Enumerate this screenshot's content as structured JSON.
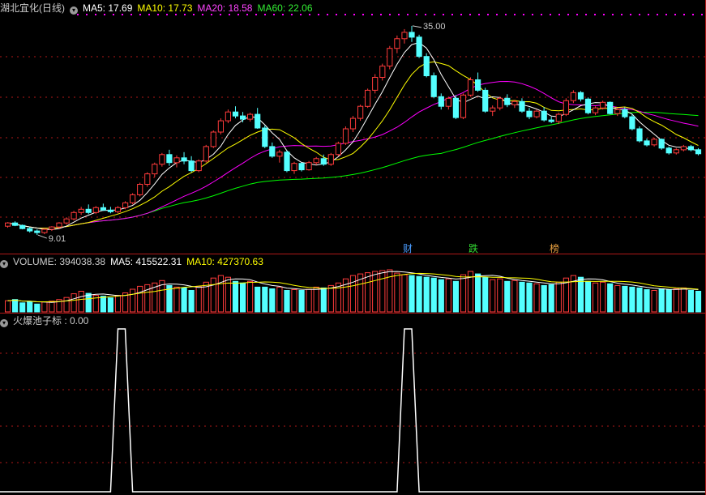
{
  "main_header": {
    "title": "湖北宜化(日线)",
    "ma5": "MA5: 17.69",
    "ma10": "MA10: 17.73",
    "ma20": "MA20: 18.58",
    "ma60": "MA60: 22.06"
  },
  "volume_header": {
    "title": "VOLUME: 394038.38",
    "ma5": "MA5: 415522.31",
    "ma10": "MA10: 427370.63"
  },
  "indicator_header": {
    "title": "火爆池子标 : 0.00"
  },
  "annotations": {
    "high": "35.00",
    "low": "9.01"
  },
  "events": [
    {
      "label": "财",
      "color": "#4a9cff"
    },
    {
      "label": "跌",
      "color": "#33dd33"
    },
    {
      "label": "榜",
      "color": "#e8a040"
    }
  ],
  "colors": {
    "up": "#ff3b3b",
    "down": "#54ffff",
    "ma5": "#ffffff",
    "ma10": "#ffff00",
    "ma20": "#ff00ff",
    "ma60": "#00ff00",
    "grid": "#b01818",
    "indicator": "#ffffff"
  },
  "chart_data": [
    {
      "type": "candlestick",
      "title": "湖北宜化(日线)",
      "ylim": [
        8,
        36
      ],
      "annotated_high": 35.0,
      "annotated_low": 9.01,
      "candles": [
        [
          10.1,
          10.6,
          9.9,
          10.5
        ],
        [
          10.5,
          10.7,
          10.1,
          10.2
        ],
        [
          10.2,
          10.3,
          9.7,
          9.8
        ],
        [
          9.8,
          10.0,
          9.3,
          9.5
        ],
        [
          9.5,
          9.7,
          9.0,
          9.3
        ],
        [
          9.3,
          9.8,
          9.1,
          9.7
        ],
        [
          9.7,
          10.1,
          9.5,
          10.0
        ],
        [
          10.0,
          10.6,
          9.8,
          10.5
        ],
        [
          10.5,
          11.2,
          10.3,
          11.0
        ],
        [
          11.0,
          12.0,
          10.8,
          11.8
        ],
        [
          11.8,
          12.5,
          11.5,
          12.2
        ],
        [
          12.2,
          12.8,
          11.6,
          11.8
        ],
        [
          11.8,
          12.6,
          11.6,
          12.4
        ],
        [
          12.4,
          12.9,
          12.0,
          12.1
        ],
        [
          12.1,
          12.5,
          11.7,
          11.9
        ],
        [
          11.9,
          12.6,
          11.7,
          12.4
        ],
        [
          12.4,
          13.2,
          12.2,
          13.0
        ],
        [
          13.0,
          14.2,
          12.8,
          14.0
        ],
        [
          14.0,
          15.5,
          13.8,
          15.3
        ],
        [
          15.3,
          16.8,
          15.0,
          16.6
        ],
        [
          16.6,
          18.0,
          16.2,
          17.8
        ],
        [
          17.8,
          19.2,
          17.5,
          19.0
        ],
        [
          19.0,
          19.6,
          17.6,
          18.0
        ],
        [
          18.0,
          18.9,
          17.4,
          18.6
        ],
        [
          18.6,
          19.3,
          17.8,
          18.2
        ],
        [
          18.2,
          18.8,
          16.8,
          17.0
        ],
        [
          17.0,
          18.4,
          16.8,
          18.2
        ],
        [
          18.2,
          20.2,
          18.0,
          20.0
        ],
        [
          20.0,
          22.0,
          19.8,
          21.8
        ],
        [
          21.8,
          23.5,
          21.5,
          23.2
        ],
        [
          23.2,
          24.6,
          22.9,
          24.3
        ],
        [
          24.3,
          25.0,
          23.5,
          23.8
        ],
        [
          23.8,
          24.3,
          23.0,
          23.4
        ],
        [
          23.4,
          24.2,
          23.1,
          24.0
        ],
        [
          24.0,
          24.8,
          22.2,
          22.3
        ],
        [
          22.3,
          22.6,
          19.8,
          20.0
        ],
        [
          20.0,
          20.5,
          18.6,
          18.8
        ],
        [
          18.8,
          19.6,
          18.0,
          19.3
        ],
        [
          19.3,
          19.5,
          16.8,
          17.0
        ],
        [
          17.0,
          18.1,
          16.6,
          17.9
        ],
        [
          17.9,
          18.0,
          16.9,
          17.1
        ],
        [
          17.1,
          18.2,
          17.0,
          18.0
        ],
        [
          18.0,
          18.7,
          17.7,
          18.5
        ],
        [
          18.5,
          19.0,
          17.6,
          17.8
        ],
        [
          17.8,
          19.2,
          17.6,
          19.0
        ],
        [
          19.0,
          20.6,
          18.8,
          20.4
        ],
        [
          20.4,
          22.5,
          20.2,
          22.2
        ],
        [
          22.2,
          23.8,
          21.8,
          23.5
        ],
        [
          23.5,
          25.2,
          23.2,
          25.0
        ],
        [
          25.0,
          27.2,
          24.8,
          27.0
        ],
        [
          27.0,
          29.0,
          26.6,
          28.6
        ],
        [
          28.6,
          30.3,
          28.2,
          30.0
        ],
        [
          30.0,
          32.5,
          29.6,
          32.2
        ],
        [
          32.2,
          33.8,
          31.6,
          33.4
        ],
        [
          33.4,
          34.6,
          32.8,
          34.2
        ],
        [
          34.2,
          35.0,
          33.0,
          33.6
        ],
        [
          33.6,
          33.9,
          31.0,
          31.2
        ],
        [
          31.2,
          31.6,
          28.6,
          28.8
        ],
        [
          28.8,
          29.2,
          26.0,
          26.2
        ],
        [
          26.2,
          26.6,
          24.6,
          25.0
        ],
        [
          25.0,
          26.2,
          24.6,
          26.0
        ],
        [
          26.0,
          26.4,
          23.4,
          23.6
        ],
        [
          23.6,
          26.6,
          23.4,
          26.4
        ],
        [
          26.4,
          28.6,
          26.2,
          28.3
        ],
        [
          28.3,
          29.2,
          26.8,
          27.0
        ],
        [
          27.0,
          27.3,
          24.2,
          24.4
        ],
        [
          24.4,
          25.1,
          23.8,
          24.8
        ],
        [
          24.8,
          26.2,
          24.5,
          26.0
        ],
        [
          26.0,
          26.5,
          24.9,
          25.2
        ],
        [
          25.2,
          25.8,
          24.8,
          25.6
        ],
        [
          25.6,
          26.0,
          24.2,
          24.4
        ],
        [
          24.4,
          24.8,
          23.4,
          23.7
        ],
        [
          23.7,
          24.6,
          23.5,
          24.4
        ],
        [
          24.4,
          24.9,
          23.1,
          23.3
        ],
        [
          23.3,
          23.7,
          22.9,
          23.1
        ],
        [
          23.1,
          24.2,
          22.8,
          24.0
        ],
        [
          24.0,
          26.0,
          23.8,
          25.7
        ],
        [
          25.7,
          27.0,
          25.4,
          26.7
        ],
        [
          26.7,
          26.9,
          25.6,
          25.9
        ],
        [
          25.9,
          26.1,
          24.0,
          24.2
        ],
        [
          24.2,
          25.0,
          23.9,
          24.8
        ],
        [
          24.8,
          25.7,
          24.6,
          25.5
        ],
        [
          25.5,
          25.6,
          24.0,
          24.1
        ],
        [
          24.1,
          24.8,
          23.8,
          24.6
        ],
        [
          24.6,
          24.9,
          23.5,
          23.7
        ],
        [
          23.7,
          24.0,
          22.0,
          22.2
        ],
        [
          22.2,
          22.5,
          20.5,
          20.7
        ],
        [
          20.7,
          21.0,
          20.0,
          20.2
        ],
        [
          20.2,
          21.1,
          20.0,
          20.9
        ],
        [
          20.9,
          21.0,
          19.6,
          19.8
        ],
        [
          19.8,
          20.0,
          19.0,
          19.2
        ],
        [
          19.2,
          19.8,
          19.0,
          19.6
        ],
        [
          19.6,
          20.2,
          19.4,
          20.0
        ],
        [
          20.0,
          20.2,
          19.4,
          19.6
        ],
        [
          19.6,
          19.8,
          18.9,
          19.1
        ]
      ]
    },
    {
      "type": "bar",
      "title": "VOLUME",
      "values": [
        27,
        30,
        22,
        25,
        19,
        24,
        26,
        30,
        35,
        44,
        50,
        45,
        40,
        38,
        34,
        40,
        46,
        55,
        62,
        66,
        70,
        76,
        64,
        60,
        58,
        52,
        62,
        72,
        82,
        88,
        84,
        74,
        70,
        74,
        60,
        60,
        56,
        60,
        52,
        54,
        52,
        55,
        60,
        58,
        64,
        70,
        80,
        88,
        92,
        95,
        98,
        100,
        102,
        94,
        90,
        88,
        86,
        84,
        82,
        78,
        80,
        74,
        90,
        98,
        92,
        84,
        78,
        80,
        74,
        76,
        72,
        70,
        68,
        64,
        66,
        72,
        82,
        88,
        84,
        74,
        70,
        72,
        68,
        64,
        62,
        60,
        58,
        54,
        52,
        56,
        54,
        56,
        58,
        52,
        50
      ],
      "ma5": 415522.31,
      "ma10": 427370.63
    },
    {
      "type": "line",
      "title": "火爆池子标",
      "ylim": [
        0,
        1
      ],
      "spikes": [
        [
          15,
          16
        ],
        [
          54,
          55
        ]
      ],
      "current": 0.0
    }
  ]
}
